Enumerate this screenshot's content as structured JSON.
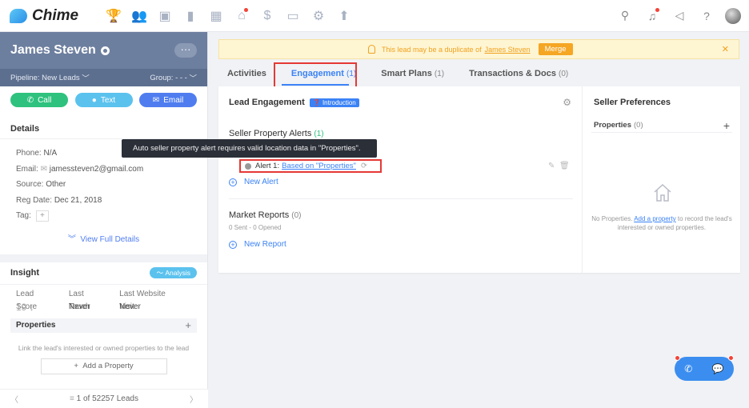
{
  "brand": {
    "name": "Chime"
  },
  "nav": {
    "icons": [
      "trophy-icon",
      "people-icon",
      "clipboard-icon",
      "bar-chart-icon",
      "grid-icon",
      "building-icon",
      "dollar-icon",
      "pulse-icon",
      "gear-icon",
      "arrow-up-icon"
    ],
    "right_icons": [
      "search-icon",
      "bell-icon",
      "speaker-icon",
      "help-icon"
    ]
  },
  "lead": {
    "name": "James Steven",
    "more": "···",
    "pipeline_label": "Pipeline:",
    "pipeline_value": "New Leads",
    "group_label": "Group:",
    "group_value": "- - -"
  },
  "actions": {
    "call": "Call",
    "text": "Text",
    "email": "Email"
  },
  "details": {
    "title": "Details",
    "phone_label": "Phone:",
    "phone": "N/A",
    "email_label": "Email:",
    "email": "jamessteven2@gmail.com",
    "source_label": "Source:",
    "source": "Other",
    "reg_label": "Reg Date:",
    "reg_date": "Dec 21, 2018",
    "tag_label": "Tag:",
    "view_full": "View Full Details"
  },
  "insight": {
    "title": "Insight",
    "analysis": "Analysis",
    "lead_score_label": "Lead Score",
    "lead_score": "19 ↓",
    "last_touch_label": "Last Touch",
    "last_touch": "Never",
    "last_visit_label": "Last Website Visit",
    "last_visit": "Never"
  },
  "properties_panel": {
    "title": "Properties",
    "note": "Link the lead's interested or owned properties to the lead",
    "add": "Add a Property"
  },
  "pager": {
    "text": "1 of 52257 Leads"
  },
  "banner": {
    "text": "This lead may be a duplicate of",
    "link": "James Steven",
    "merge": "Merge"
  },
  "tabs": [
    {
      "label": "Activities",
      "count": ""
    },
    {
      "label": "Engagement",
      "count": "(1)"
    },
    {
      "label": "Smart Plans",
      "count": "(1)"
    },
    {
      "label": "Transactions & Docs",
      "count": "(0)"
    }
  ],
  "engagement": {
    "title": "Lead Engagement",
    "intro": "Introduction",
    "spa_title": "Seller Property Alerts",
    "spa_count": "(1)",
    "alert_label": "Alert 1:",
    "alert_link": "Based on \"Properties\"",
    "new_alert": "New Alert",
    "mr_title": "Market Reports",
    "mr_count": "(0)",
    "mr_sub": "0 Sent - 0 Opened",
    "new_report": "New Report",
    "tooltip": "Auto seller property alert requires valid location data in \"Properties\"."
  },
  "seller_prefs": {
    "title": "Seller Preferences",
    "properties": "Properties",
    "count": "(0)",
    "note_pre": "No Properties.",
    "note_link": "Add a property",
    "note_post": "to record the lead's interested or owned properties."
  },
  "colors": {
    "accent": "#3b82f6",
    "header": "#6d7f9f",
    "call": "#2ec27e",
    "text": "#5bc2ee",
    "email": "#4f7df0",
    "highlight": "#e53935"
  }
}
